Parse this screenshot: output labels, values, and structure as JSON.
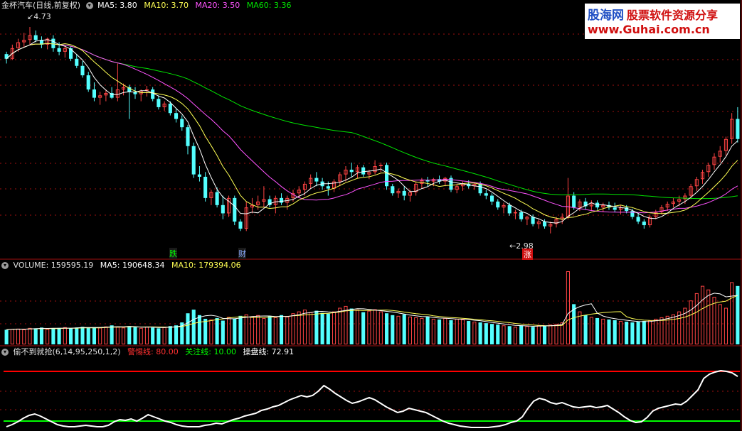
{
  "colors": {
    "up": "#ff4444",
    "down": "#54ffff",
    "ma5": "#ffffff",
    "ma10": "#ffff54",
    "ma20": "#ff54ff",
    "ma60": "#00e600",
    "grid": "#a01010",
    "indicator_line": "#ffffff",
    "warn_line": "#ff0000",
    "focus_line": "#00ff00",
    "vol_ma5": "#ffffff",
    "vol_ma10": "#ffff54"
  },
  "price_panel": {
    "title": "金杯汽车(日线,前复权)",
    "ma5": {
      "label": "MA5: 3.80"
    },
    "ma10": {
      "label": "MA10: 3.70"
    },
    "ma20": {
      "label": "MA20: 3.50"
    },
    "ma60": {
      "label": "MA60: 3.36"
    },
    "high_label": "4.73",
    "low_label": "2.98",
    "event_labels": [
      {
        "text": "跌",
        "color": "#00ff00"
      },
      {
        "text": "财",
        "color": "#88aaff"
      },
      {
        "text": "涨",
        "color": "#ff4444"
      }
    ]
  },
  "volume_panel": {
    "name": "VOLUME: 159595.19",
    "ma5": "MA5: 190648.34",
    "ma10": "MA10: 179394.06"
  },
  "indicator_panel": {
    "name": "偷不到就抢(6,14,95,250,1,2)",
    "warn": "警惕线: 80.00",
    "focus": "关注线: 10.00",
    "line": "操盘线: 72.91"
  },
  "watermark": {
    "brand": "股海网",
    "slogan": "股票软件资源分享",
    "url": "www.Guhai.com.cn"
  },
  "chart_data": [
    {
      "type": "candlestick",
      "title": "金杯汽车(日线,前复权)",
      "ylim": [
        2.9,
        4.85
      ],
      "ohlc": [
        [
          4.5,
          4.52,
          4.42,
          4.46
        ],
        [
          4.46,
          4.58,
          4.45,
          4.55
        ],
        [
          4.55,
          4.63,
          4.52,
          4.6
        ],
        [
          4.6,
          4.68,
          4.56,
          4.62
        ],
        [
          4.62,
          4.73,
          4.58,
          4.66
        ],
        [
          4.66,
          4.7,
          4.6,
          4.62
        ],
        [
          4.62,
          4.65,
          4.55,
          4.58
        ],
        [
          4.58,
          4.64,
          4.54,
          4.63
        ],
        [
          4.63,
          4.66,
          4.52,
          4.55
        ],
        [
          4.55,
          4.6,
          4.49,
          4.52
        ],
        [
          4.52,
          4.58,
          4.47,
          4.55
        ],
        [
          4.55,
          4.57,
          4.44,
          4.46
        ],
        [
          4.46,
          4.5,
          4.38,
          4.4
        ],
        [
          4.4,
          4.44,
          4.3,
          4.32
        ],
        [
          4.32,
          4.35,
          4.18,
          4.2
        ],
        [
          4.2,
          4.26,
          4.1,
          4.13
        ],
        [
          4.13,
          4.18,
          4.07,
          4.15
        ],
        [
          4.15,
          4.2,
          4.1,
          4.17
        ],
        [
          4.17,
          4.22,
          4.12,
          4.13
        ],
        [
          4.13,
          4.42,
          4.1,
          4.2
        ],
        [
          4.2,
          4.25,
          4.15,
          4.22
        ],
        [
          4.22,
          4.24,
          3.95,
          4.18
        ],
        [
          4.18,
          4.22,
          4.12,
          4.16
        ],
        [
          4.16,
          4.2,
          4.1,
          4.19
        ],
        [
          4.19,
          4.23,
          4.14,
          4.2
        ],
        [
          4.2,
          4.22,
          4.1,
          4.12
        ],
        [
          4.12,
          4.15,
          4.03,
          4.05
        ],
        [
          4.05,
          4.1,
          4.02,
          4.08
        ],
        [
          4.08,
          4.1,
          3.98,
          4.0
        ],
        [
          4.0,
          4.04,
          3.92,
          3.95
        ],
        [
          3.95,
          3.98,
          3.85,
          3.88
        ],
        [
          3.88,
          3.9,
          3.65,
          3.72
        ],
        [
          3.72,
          3.75,
          3.45,
          3.48
        ],
        [
          3.48,
          3.55,
          3.42,
          3.46
        ],
        [
          3.46,
          3.5,
          3.25,
          3.28
        ],
        [
          3.28,
          3.35,
          3.22,
          3.33
        ],
        [
          3.33,
          3.37,
          3.2,
          3.22
        ],
        [
          3.22,
          3.3,
          3.1,
          3.15
        ],
        [
          3.15,
          3.3,
          3.12,
          3.28
        ],
        [
          3.28,
          3.3,
          3.05,
          3.08
        ],
        [
          3.08,
          3.1,
          3.0,
          3.02
        ],
        [
          3.02,
          3.25,
          3.0,
          3.2
        ],
        [
          3.2,
          3.28,
          3.15,
          3.22
        ],
        [
          3.22,
          3.3,
          3.18,
          3.25
        ],
        [
          3.25,
          3.38,
          3.2,
          3.27
        ],
        [
          3.27,
          3.3,
          3.2,
          3.22
        ],
        [
          3.22,
          3.3,
          3.15,
          3.28
        ],
        [
          3.28,
          3.32,
          3.22,
          3.24
        ],
        [
          3.24,
          3.3,
          3.18,
          3.28
        ],
        [
          3.28,
          3.35,
          3.25,
          3.32
        ],
        [
          3.32,
          3.38,
          3.28,
          3.35
        ],
        [
          3.35,
          3.42,
          3.3,
          3.4
        ],
        [
          3.4,
          3.48,
          3.36,
          3.45
        ],
        [
          3.45,
          3.5,
          3.38,
          3.42
        ],
        [
          3.42,
          3.45,
          3.35,
          3.38
        ],
        [
          3.38,
          3.42,
          3.3,
          3.36
        ],
        [
          3.36,
          3.44,
          3.33,
          3.42
        ],
        [
          3.42,
          3.5,
          3.38,
          3.48
        ],
        [
          3.48,
          3.55,
          3.42,
          3.52
        ],
        [
          3.52,
          3.58,
          3.46,
          3.5
        ],
        [
          3.5,
          3.56,
          3.45,
          3.54
        ],
        [
          3.54,
          3.56,
          3.46,
          3.48
        ],
        [
          3.48,
          3.52,
          3.44,
          3.5
        ],
        [
          3.5,
          3.6,
          3.48,
          3.55
        ],
        [
          3.55,
          3.58,
          3.5,
          3.56
        ],
        [
          3.56,
          3.58,
          3.35,
          3.38
        ],
        [
          3.38,
          3.4,
          3.3,
          3.32
        ],
        [
          3.32,
          3.36,
          3.28,
          3.34
        ],
        [
          3.34,
          3.38,
          3.26,
          3.3
        ],
        [
          3.3,
          3.35,
          3.25,
          3.33
        ],
        [
          3.33,
          3.42,
          3.3,
          3.4
        ],
        [
          3.4,
          3.45,
          3.36,
          3.43
        ],
        [
          3.43,
          3.46,
          3.38,
          3.42
        ],
        [
          3.42,
          3.45,
          3.38,
          3.44
        ],
        [
          3.44,
          3.47,
          3.4,
          3.42
        ],
        [
          3.42,
          3.46,
          3.38,
          3.45
        ],
        [
          3.45,
          3.47,
          3.33,
          3.35
        ],
        [
          3.35,
          3.4,
          3.32,
          3.38
        ],
        [
          3.38,
          3.42,
          3.34,
          3.4
        ],
        [
          3.4,
          3.43,
          3.36,
          3.38
        ],
        [
          3.38,
          3.41,
          3.35,
          3.4
        ],
        [
          3.4,
          3.42,
          3.3,
          3.32
        ],
        [
          3.32,
          3.35,
          3.27,
          3.3
        ],
        [
          3.3,
          3.32,
          3.22,
          3.25
        ],
        [
          3.25,
          3.27,
          3.18,
          3.2
        ],
        [
          3.2,
          3.24,
          3.15,
          3.22
        ],
        [
          3.22,
          3.24,
          3.13,
          3.15
        ],
        [
          3.15,
          3.18,
          3.1,
          3.16
        ],
        [
          3.16,
          3.18,
          3.08,
          3.1
        ],
        [
          3.1,
          3.13,
          3.05,
          3.12
        ],
        [
          3.12,
          3.14,
          3.04,
          3.06
        ],
        [
          3.06,
          3.1,
          3.02,
          3.08
        ],
        [
          3.08,
          3.1,
          3.02,
          3.04
        ],
        [
          3.04,
          3.08,
          2.98,
          3.06
        ],
        [
          3.06,
          3.12,
          3.03,
          3.1
        ],
        [
          3.1,
          3.15,
          3.06,
          3.12
        ],
        [
          3.12,
          3.45,
          3.1,
          3.3
        ],
        [
          3.3,
          3.33,
          3.18,
          3.2
        ],
        [
          3.2,
          3.27,
          3.17,
          3.25
        ],
        [
          3.25,
          3.28,
          3.18,
          3.21
        ],
        [
          3.21,
          3.26,
          3.17,
          3.24
        ],
        [
          3.24,
          3.26,
          3.18,
          3.2
        ],
        [
          3.2,
          3.24,
          3.16,
          3.22
        ],
        [
          3.22,
          3.25,
          3.18,
          3.2
        ],
        [
          3.2,
          3.24,
          3.16,
          3.18
        ],
        [
          3.18,
          3.22,
          3.14,
          3.2
        ],
        [
          3.2,
          3.22,
          3.15,
          3.17
        ],
        [
          3.17,
          3.19,
          3.1,
          3.12
        ],
        [
          3.12,
          3.15,
          3.06,
          3.08
        ],
        [
          3.08,
          3.1,
          3.02,
          3.05
        ],
        [
          3.05,
          3.14,
          3.03,
          3.12
        ],
        [
          3.12,
          3.18,
          3.1,
          3.16
        ],
        [
          3.16,
          3.22,
          3.14,
          3.2
        ],
        [
          3.2,
          3.25,
          3.17,
          3.23
        ],
        [
          3.23,
          3.28,
          3.2,
          3.25
        ],
        [
          3.25,
          3.3,
          3.21,
          3.27
        ],
        [
          3.27,
          3.32,
          3.23,
          3.3
        ],
        [
          3.3,
          3.4,
          3.27,
          3.38
        ],
        [
          3.38,
          3.46,
          3.34,
          3.44
        ],
        [
          3.44,
          3.52,
          3.4,
          3.5
        ],
        [
          3.5,
          3.58,
          3.46,
          3.56
        ],
        [
          3.56,
          3.66,
          3.52,
          3.63
        ],
        [
          3.63,
          3.72,
          3.58,
          3.68
        ],
        [
          3.68,
          3.8,
          3.64,
          3.78
        ],
        [
          3.78,
          4.0,
          3.74,
          3.95
        ],
        [
          3.95,
          4.05,
          3.75,
          3.78
        ]
      ]
    },
    {
      "type": "bar",
      "title": "VOLUME",
      "ylim": [
        0,
        200000
      ],
      "values": [
        40000,
        42000,
        43000,
        41000,
        45000,
        44000,
        46000,
        42000,
        43000,
        45000,
        47000,
        44000,
        46000,
        48000,
        45000,
        47000,
        46000,
        49000,
        52000,
        48000,
        46000,
        50000,
        47000,
        45000,
        48000,
        46000,
        44000,
        47000,
        50000,
        52000,
        60000,
        85000,
        95000,
        80000,
        70000,
        68000,
        72000,
        65000,
        75000,
        70000,
        78000,
        82000,
        76000,
        80000,
        72000,
        78000,
        74000,
        80000,
        76000,
        85000,
        90000,
        95000,
        88000,
        92000,
        86000,
        84000,
        90000,
        100000,
        105000,
        98000,
        95000,
        88000,
        92000,
        96000,
        90000,
        85000,
        80000,
        78000,
        82000,
        76000,
        74000,
        72000,
        76000,
        70000,
        68000,
        72000,
        66000,
        70000,
        68000,
        64000,
        62000,
        60000,
        58000,
        56000,
        54000,
        52000,
        50000,
        48000,
        52000,
        50000,
        48000,
        52000,
        50000,
        54000,
        56000,
        60000,
        200000,
        110000,
        90000,
        80000,
        75000,
        72000,
        70000,
        68000,
        66000,
        64000,
        62000,
        60000,
        62000,
        64000,
        66000,
        70000,
        74000,
        78000,
        82000,
        90000,
        100000,
        120000,
        140000,
        160000,
        150000,
        130000,
        110000,
        100000,
        170000,
        159595
      ]
    },
    {
      "type": "line",
      "title": "偷不到就抢",
      "ylim": [
        0,
        100
      ],
      "series": [
        {
          "name": "操盘线",
          "values": [
            2,
            5,
            9,
            14,
            18,
            20,
            17,
            13,
            9,
            5,
            3,
            2,
            2,
            3,
            4,
            3,
            2,
            2,
            4,
            9,
            12,
            11,
            13,
            10,
            14,
            19,
            16,
            13,
            10,
            8,
            5,
            3,
            2,
            2,
            2,
            4,
            5,
            7,
            6,
            9,
            12,
            14,
            17,
            19,
            21,
            25,
            27,
            30,
            32,
            36,
            40,
            43,
            46,
            44,
            46,
            52,
            60,
            55,
            49,
            44,
            39,
            35,
            37,
            40,
            43,
            40,
            35,
            30,
            26,
            22,
            24,
            28,
            26,
            24,
            22,
            18,
            14,
            10,
            7,
            5,
            3,
            2,
            1,
            1,
            1,
            1,
            2,
            3,
            5,
            8,
            10,
            16,
            28,
            38,
            42,
            40,
            36,
            34,
            36,
            33,
            30,
            29,
            30,
            31,
            29,
            30,
            32,
            27,
            22,
            16,
            11,
            8,
            9,
            15,
            24,
            28,
            30,
            32,
            34,
            33,
            38,
            46,
            54,
            70,
            76,
            79,
            81,
            80,
            78,
            72.91
          ]
        },
        {
          "name": "警惕线",
          "values": [
            80
          ]
        },
        {
          "name": "关注线",
          "values": [
            10
          ]
        }
      ]
    }
  ]
}
